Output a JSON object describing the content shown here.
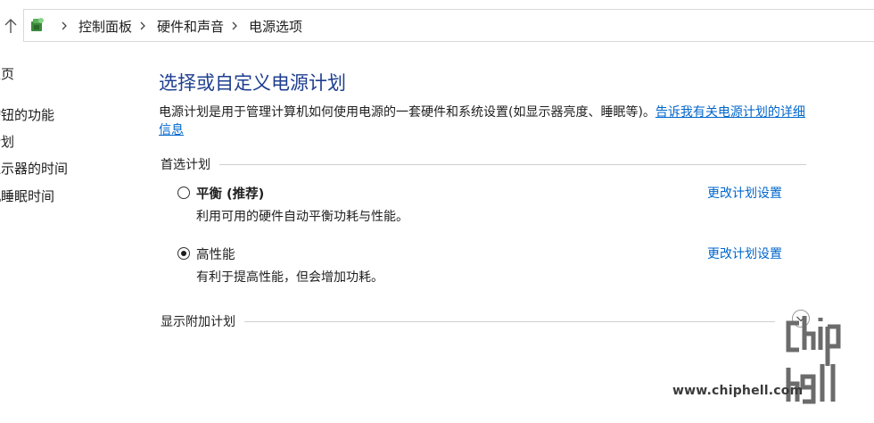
{
  "breadcrumb": {
    "items": [
      "控制面板",
      "硬件和声音",
      "电源选项"
    ]
  },
  "sidebar": {
    "links": [
      "主页",
      "按钮的功能",
      "计划",
      "显示器的时间",
      "机睡眠时间"
    ]
  },
  "main": {
    "title": "选择或自定义电源计划",
    "description": "电源计划是用于管理计算机如何使用电源的一套硬件和系统设置(如显示器亮度、睡眠等)。",
    "help_link": "告诉我有关电源计划的详细信息",
    "preferred_header": "首选计划",
    "plans": [
      {
        "name": "平衡 (推荐)",
        "description": "利用可用的硬件自动平衡功耗与性能。",
        "selected": false,
        "change_link": "更改计划设置"
      },
      {
        "name": "高性能",
        "description": "有利于提高性能，但会增加功耗。",
        "selected": true,
        "change_link": "更改计划设置"
      }
    ],
    "additional_header": "显示附加计划"
  },
  "watermark": {
    "site": "www.chiphell.com",
    "logo_text": "chip hell"
  },
  "colors": {
    "title": "#1e3e8f",
    "link": "#0066cc",
    "divider": "#cfcfcf"
  }
}
